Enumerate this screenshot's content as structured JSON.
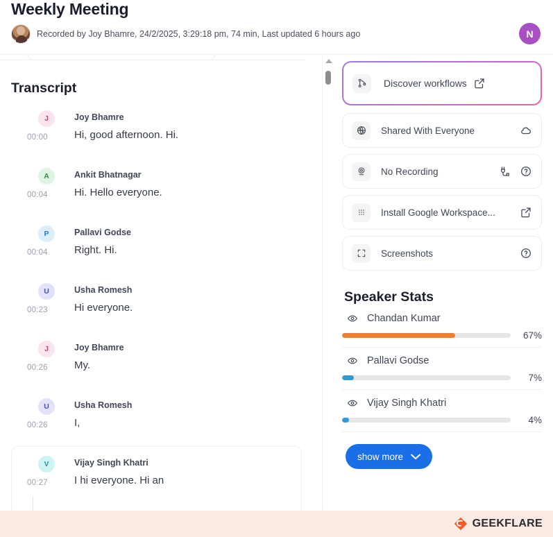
{
  "header": {
    "title": "Weekly Meeting",
    "meta": "Recorded by Joy Bhamre, 24/2/2025, 3:29:18 pm, 74 min, Last updated 6 hours ago",
    "user_initial": "N",
    "recorder_avatar_name": "joy-bhamre-photo"
  },
  "transcript": {
    "title": "Transcript",
    "entries": [
      {
        "initial": "J",
        "name": "Joy Bhamre",
        "time": "00:00",
        "text": "Hi, good afternoon. Hi.",
        "bg": "#fbe4ec",
        "fg": "#c2436b",
        "highlighted": false
      },
      {
        "initial": "A",
        "name": "Ankit Bhatnagar",
        "time": "00:04",
        "text": "Hi. Hello everyone.",
        "bg": "#dff5e3",
        "fg": "#2f8b46",
        "highlighted": false
      },
      {
        "initial": "P",
        "name": "Pallavi Godse",
        "time": "00:04",
        "text": "Right. Hi.",
        "bg": "#dceefb",
        "fg": "#2b7cb8",
        "highlighted": false
      },
      {
        "initial": "U",
        "name": "Usha Romesh",
        "time": "00:23",
        "text": "Hi everyone.",
        "bg": "#e2e2fb",
        "fg": "#4b4fc0",
        "highlighted": false
      },
      {
        "initial": "J",
        "name": "Joy Bhamre",
        "time": "00:26",
        "text": "My.",
        "bg": "#fbe4ec",
        "fg": "#c2436b",
        "highlighted": false
      },
      {
        "initial": "U",
        "name": "Usha Romesh",
        "time": "00:26",
        "text": "I,",
        "bg": "#e2e2fb",
        "fg": "#4b4fc0",
        "highlighted": false
      },
      {
        "initial": "V",
        "name": "Vijay Singh Khatri",
        "time": "00:27",
        "text": "I hi everyone. Hi an",
        "bg": "#cdf3f4",
        "fg": "#2b8f96",
        "highlighted": true
      }
    ]
  },
  "sidebar": {
    "cards": [
      {
        "label": "Discover workflows",
        "icon": "git-branch-icon",
        "featured": true,
        "actions": [
          "external-link-icon"
        ]
      },
      {
        "label": "Shared With Everyone",
        "icon": "globe-icon",
        "featured": false,
        "actions": [
          "cloud-icon"
        ]
      },
      {
        "label": "No Recording",
        "icon": "camera-record-icon",
        "featured": false,
        "actions": [
          "plug-icon",
          "help-circle-icon"
        ]
      },
      {
        "label": "Install Google Workspace...",
        "icon": "grid-dots-icon",
        "featured": false,
        "actions": [
          "external-link-icon"
        ]
      },
      {
        "label": "Screenshots",
        "icon": "crop-frame-icon",
        "featured": false,
        "actions": [
          "help-circle-icon"
        ]
      }
    ]
  },
  "speaker_stats": {
    "title": "Speaker Stats",
    "show_more_label": "show more",
    "speakers": [
      {
        "name": "Chandan Kumar",
        "percent": "67%",
        "value": 67,
        "color": "#ed7d31"
      },
      {
        "name": "Pallavi Godse",
        "percent": "7%",
        "value": 7,
        "color": "#2e9bd6"
      },
      {
        "name": "Vijay Singh Khatri",
        "percent": "4%",
        "value": 4,
        "color": "#2e9bd6"
      }
    ]
  },
  "footer": {
    "brand": "GEEKFLARE",
    "brand_color": "#f05a28",
    "background": "#faeae4"
  }
}
